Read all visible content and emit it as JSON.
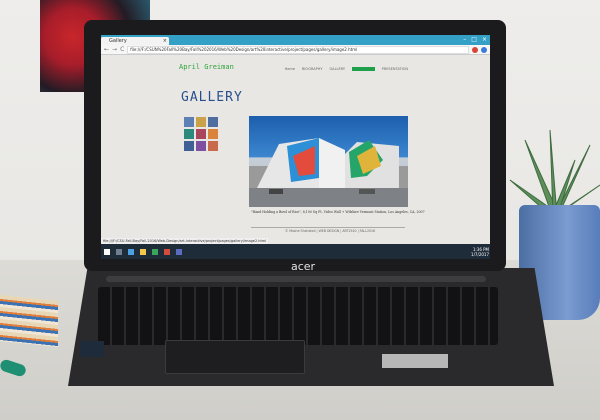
{
  "browser": {
    "tab_title": "Gallery",
    "tab_close": "×",
    "window_buttons": [
      "–",
      "□",
      "×"
    ],
    "nav": {
      "back": "←",
      "forward": "→",
      "reload": "C"
    },
    "url": "file:///F:/CSUN%20Fall%20Bay/Fall%202016/Web%20Design/art%20interactive/project/pages/gallery/image2.html",
    "status_url": "file:///F:/CSU-Fall-Bay/Fall-2016/Web-Design/art-interactive/project/pages/gallery/image2.html"
  },
  "site": {
    "title": "April Greiman",
    "menu": [
      "Home",
      "BIOGRAPHY",
      "GALLERY",
      "CONTACT",
      "PRESENTATION"
    ],
    "active_menu_index": 3,
    "heading": "GALLERY",
    "caption": "\"Hand Holding a Bowl of Rice\", 8,100 Sq Ft, Video Wall + Wilshire Vermont Station, Los Angeles, CA, 2007",
    "footer": "© Moshe Shohatali | WEB DESIGN | ART2520 | FALL2016",
    "thumb_colors": [
      "#5d7fb4",
      "#c9a24a",
      "#4e6ea0",
      "#2b8a7c",
      "#a8465d",
      "#d9843a",
      "#3f5f95",
      "#7f4fa0",
      "#c86b4c"
    ]
  },
  "taskbar": {
    "time": "1:36 PM",
    "date": "1/7/2017"
  },
  "laptop": {
    "brand": "acer"
  }
}
